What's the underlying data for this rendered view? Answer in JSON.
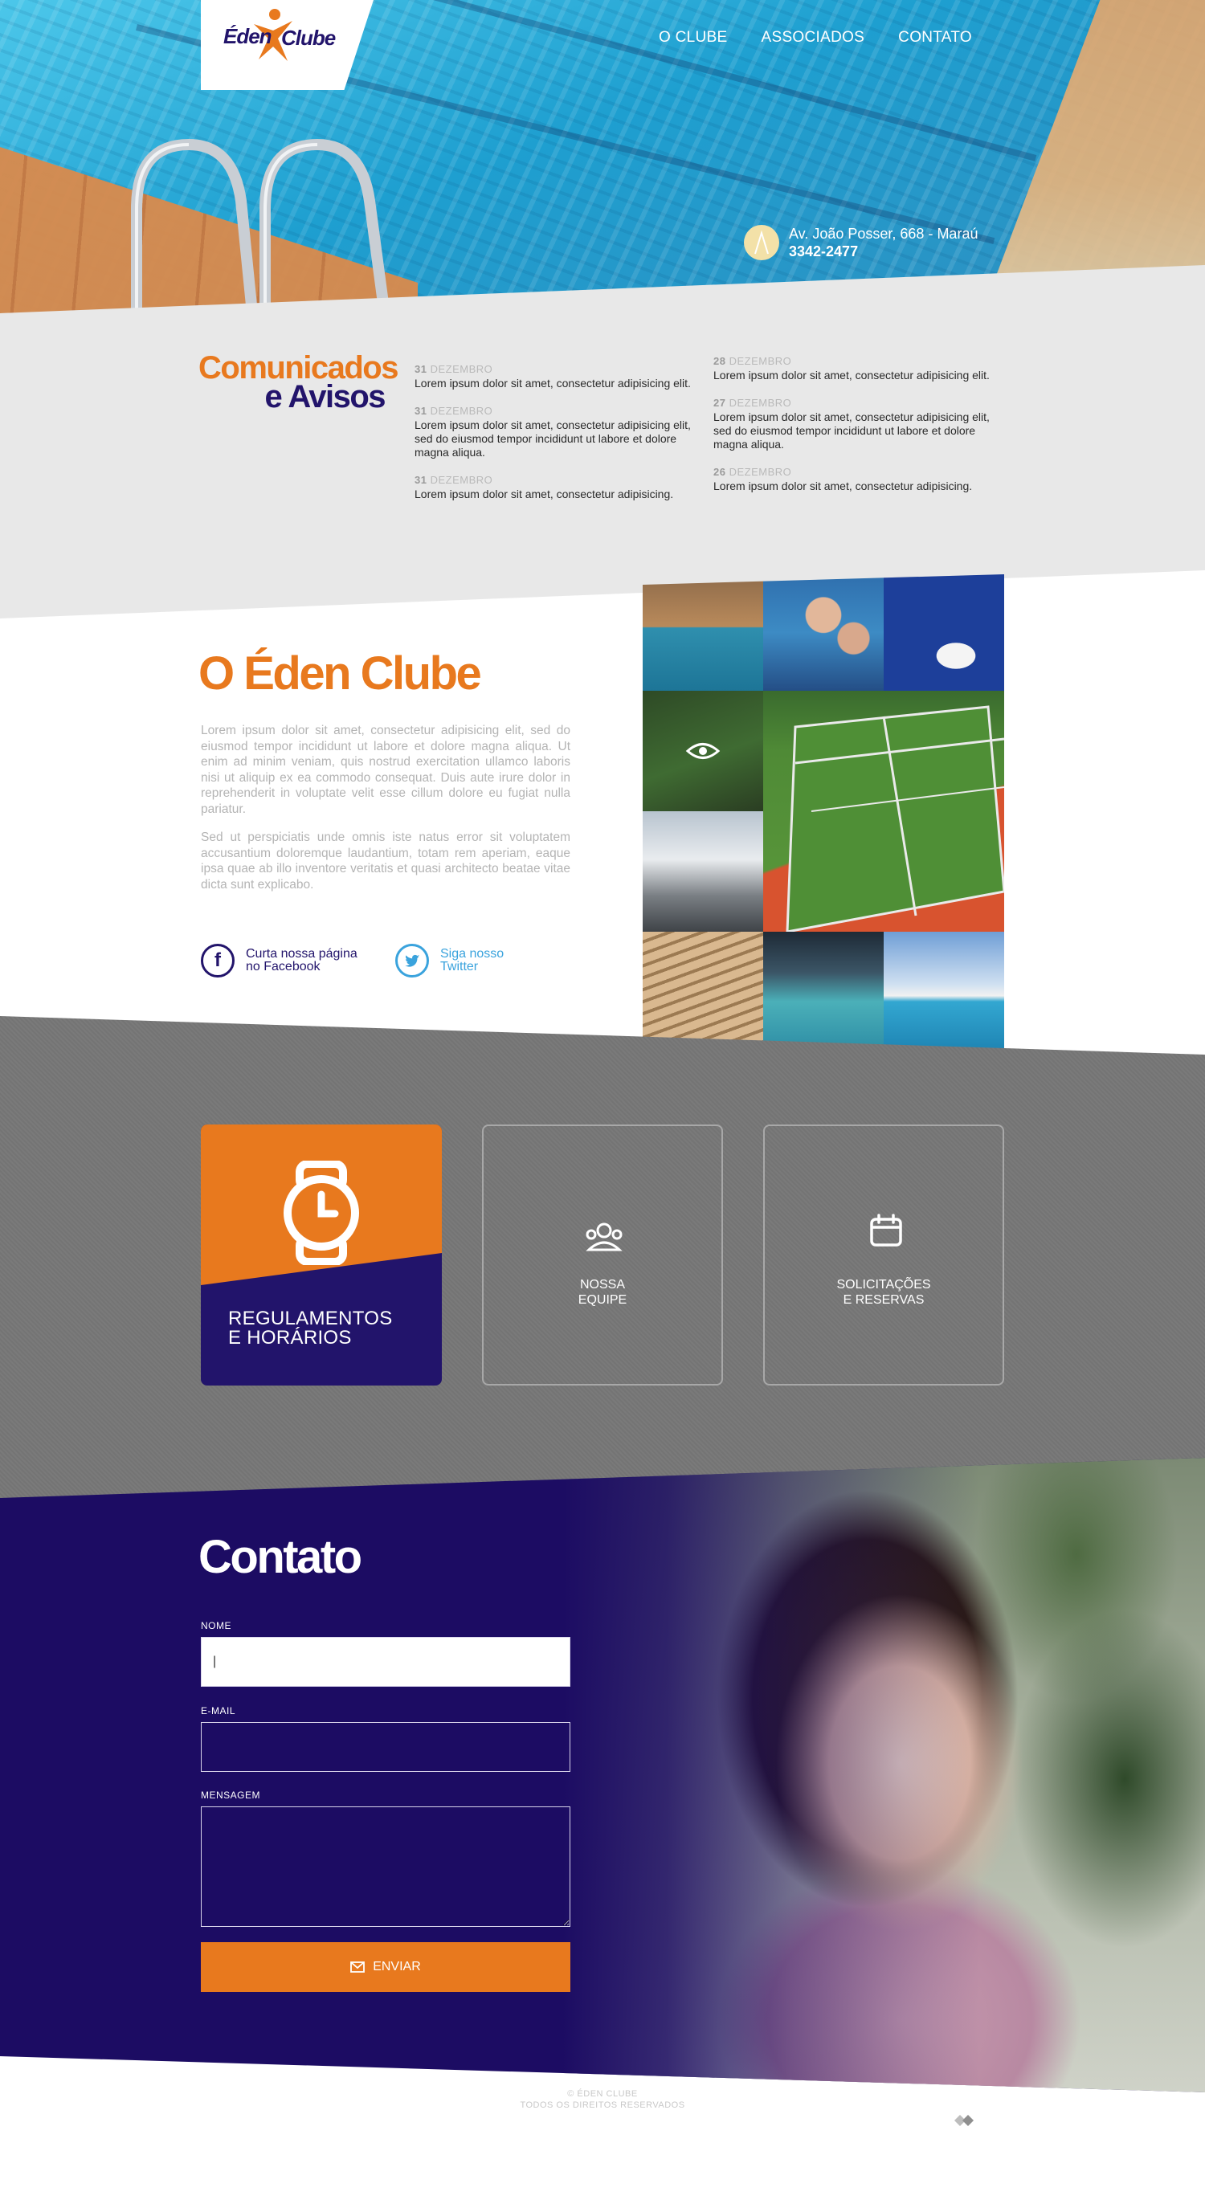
{
  "brand": {
    "logo_word1": "Éden",
    "logo_word2": "Clube",
    "primary_color": "#22146b",
    "accent_color": "#e8791e"
  },
  "nav": {
    "items": [
      {
        "label": "O CLUBE"
      },
      {
        "label": "ASSOCIADOS"
      },
      {
        "label": "CONTATO"
      }
    ]
  },
  "hero": {
    "address": "Av. João Posser, 668 - Maraú",
    "phone": "3342-2477"
  },
  "news": {
    "title_line1": "Comunicados",
    "title_line2": "e Avisos",
    "columns": [
      [
        {
          "day": "31",
          "month": "DEZEMBRO",
          "text": "Lorem ipsum dolor sit amet, consectetur adipisicing elit."
        },
        {
          "day": "31",
          "month": "DEZEMBRO",
          "text": "Lorem ipsum dolor sit amet, consectetur adipisicing elit, sed do eiusmod tempor incididunt ut labore et dolore magna aliqua."
        },
        {
          "day": "31",
          "month": "DEZEMBRO",
          "text": "Lorem ipsum dolor sit amet, consectetur adipisicing."
        }
      ],
      [
        {
          "day": "28",
          "month": "DEZEMBRO",
          "text": "Lorem ipsum dolor sit amet, consectetur adipisicing elit."
        },
        {
          "day": "27",
          "month": "DEZEMBRO",
          "text": "Lorem ipsum dolor sit amet, consectetur adipisicing elit, sed do eiusmod tempor incididunt ut labore et dolore magna aliqua."
        },
        {
          "day": "26",
          "month": "DEZEMBRO",
          "text": "Lorem ipsum dolor sit amet, consectetur adipisicing."
        }
      ]
    ]
  },
  "about": {
    "title": "O Éden Clube",
    "paragraph1": "Lorem ipsum dolor sit amet, consectetur adipisicing elit, sed do eiusmod tempor incididunt ut labore et dolore magna aliqua. Ut enim ad minim veniam, quis nostrud exercitation ullamco laboris nisi ut aliquip ex ea commodo consequat. Duis aute irure dolor in reprehenderit in voluptate velit esse cillum dolore eu fugiat nulla pariatur.",
    "paragraph2": "Sed ut perspiciatis unde omnis iste natus error sit voluptatem accusantium doloremque laudantium, totam rem aperiam, eaque ipsa quae ab illo inventore veritatis et quasi architecto beatae vitae dicta sunt explicabo.",
    "facebook_line1": "Curta nossa página",
    "facebook_line2": "no Facebook",
    "twitter_line1": "Siga nosso",
    "twitter_line2": "Twitter",
    "facebook_color": "#22146b",
    "twitter_color": "#3aa3dd"
  },
  "services": {
    "cards": [
      {
        "line1": "REGULAMENTOS",
        "line2": "E HORÁRIOS",
        "icon": "watch-icon"
      },
      {
        "line1": "NOSSA",
        "line2": "EQUIPE",
        "icon": "team-icon"
      },
      {
        "line1": "SOLICITAÇÕES",
        "line2": "E RESERVAS",
        "icon": "calendar-icon"
      }
    ]
  },
  "contact": {
    "title": "Contato",
    "name_label": "NOME",
    "name_value": "|",
    "email_label": "E-MAIL",
    "message_label": "MENSAGEM",
    "send_label": "ENVIAR"
  },
  "footer": {
    "line1": "© ÉDEN CLUBE",
    "line2": "TODOS OS DIREITOS RESERVADOS"
  }
}
